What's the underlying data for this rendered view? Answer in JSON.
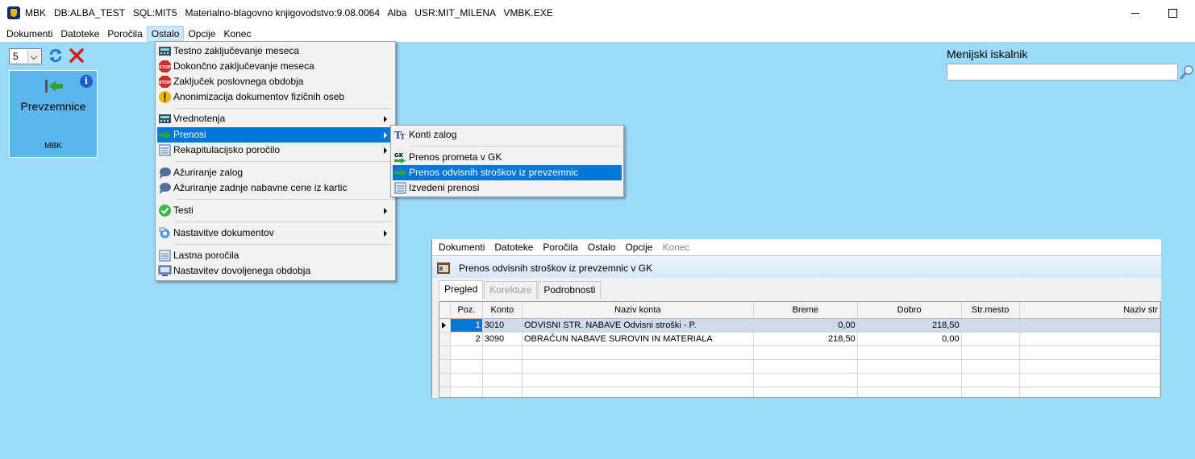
{
  "window": {
    "title": "MBK   DB:ALBA_TEST   SQL:MIT5   Materialno-blagovno knjigovodstvo:9.08.0064   Alba   USR:MIT_MILENA   VMBK.EXE"
  },
  "menubar": {
    "items": [
      "Dokumenti",
      "Datoteke",
      "Poročila",
      "Ostalo",
      "Opcije",
      "Konec"
    ]
  },
  "toolbar": {
    "combo_value": "5"
  },
  "tile": {
    "title": "Prevzemnice",
    "subtitle": "MBK",
    "info": "i"
  },
  "search": {
    "label": "Menijski iskalnik",
    "value": ""
  },
  "ostalo_menu": {
    "items": [
      {
        "label": "Testno zaključevanje meseca",
        "icon": "calculator-icon"
      },
      {
        "label": "Dokončno zaključevanje meseca",
        "icon": "stop-icon"
      },
      {
        "label": "Zaključek poslovnega obdobja",
        "icon": "stop-icon"
      },
      {
        "label": "Anonimizacija dokumentov fizičnih oseb",
        "icon": "warning-icon"
      },
      {
        "label": "Vrednotenja",
        "icon": "calculator-icon",
        "submenu": true
      },
      {
        "label": "Prenosi",
        "icon": "arrow-right-icon",
        "submenu": true,
        "highlighted": true
      },
      {
        "label": "Rekapitulacijsko poročilo",
        "icon": "list-icon",
        "submenu": true
      },
      {
        "label": "Ažuriranje zalog",
        "icon": "speech-bubble-icon"
      },
      {
        "label": "Ažuriranje zadnje nabavne cene iz kartic",
        "icon": "speech-bubble-icon"
      },
      {
        "label": "Testi",
        "icon": "check-icon",
        "submenu": true
      },
      {
        "label": "Nastavitve dokumentov",
        "icon": "settings-icon",
        "submenu": true
      },
      {
        "label": "Lastna poročila",
        "icon": "list-icon"
      },
      {
        "label": "Nastavitev dovoljenega obdobja",
        "icon": "computer-icon"
      }
    ]
  },
  "prenosi_menu": {
    "items": [
      {
        "label": "Konti zalog",
        "icon": "text-icon"
      },
      {
        "label": "Prenos prometa v GK",
        "icon": "gk-arrow-icon"
      },
      {
        "label": "Prenos odvisnih stroškov iz prevzemnic",
        "icon": "arrow-right-icon",
        "highlighted": true
      },
      {
        "label": "Izvedeni prenosi",
        "icon": "list-icon"
      }
    ],
    "gk_label": "GK"
  },
  "inner_window": {
    "menubar": [
      "Dokumenti",
      "Datoteke",
      "Poročila",
      "Ostalo",
      "Opcije",
      "Konec"
    ],
    "title": "Prenos odvisnih stroškov iz prevzemnic v GK",
    "tabs": [
      "Pregled",
      "Korekture",
      "Podrobnosti"
    ],
    "grid": {
      "columns": [
        "Poz.",
        "Konto",
        "Naziv konta",
        "Breme",
        "Dobro",
        "Str.mesto",
        "Naziv str"
      ],
      "rows": [
        {
          "poz": "1",
          "konto": "3010",
          "naziv": "ODVISNI STR. NABAVE Odvisni stroški - P.",
          "breme": "0,00",
          "dobro": "218,50",
          "str_mesto": "",
          "naziv_str": ""
        },
        {
          "poz": "2",
          "konto": "3090",
          "naziv": "OBRAČUN NABAVE SUROVIN IN MATERIALA",
          "breme": "218,50",
          "dobro": "0,00",
          "str_mesto": "",
          "naziv_str": ""
        }
      ]
    }
  },
  "colors": {
    "desktop": "#9bdaf8",
    "tile": "#5cb6eb",
    "highlight": "#0078d7",
    "menubar_active": "#cce8ff"
  }
}
